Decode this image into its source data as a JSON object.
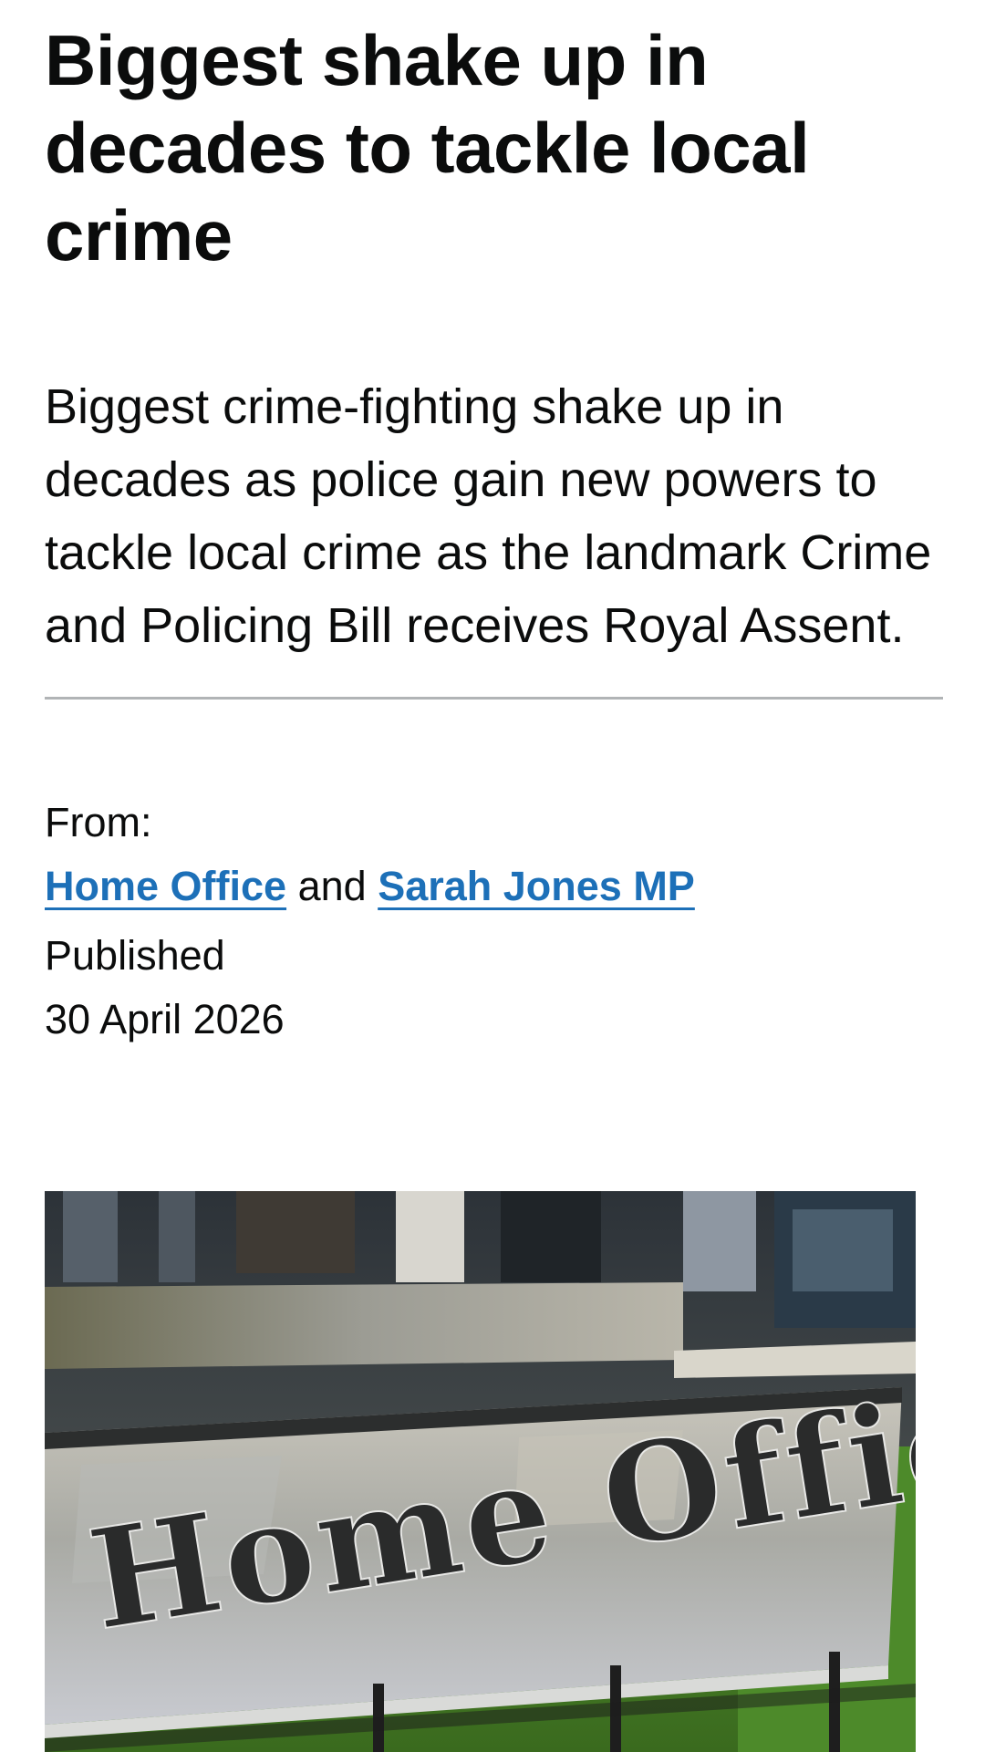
{
  "article": {
    "title": "Biggest shake up in decades to tackle local crime",
    "lead": "Biggest crime-fighting shake up in decades as police gain new powers to tackle local crime as the landmark Crime and Policing Bill receives Royal Assent."
  },
  "metadata": {
    "from_label": "From:",
    "organisations": [
      {
        "name": "Home Office"
      },
      {
        "name": "Sarah Jones MP"
      }
    ],
    "conjunction": "and",
    "published_label": "Published",
    "published_date": "30 April 2026"
  },
  "image": {
    "sign_text": "Home Office"
  },
  "colors": {
    "link": "#1d70b8",
    "text": "#0b0c0c",
    "divider": "#b1b4b6"
  }
}
